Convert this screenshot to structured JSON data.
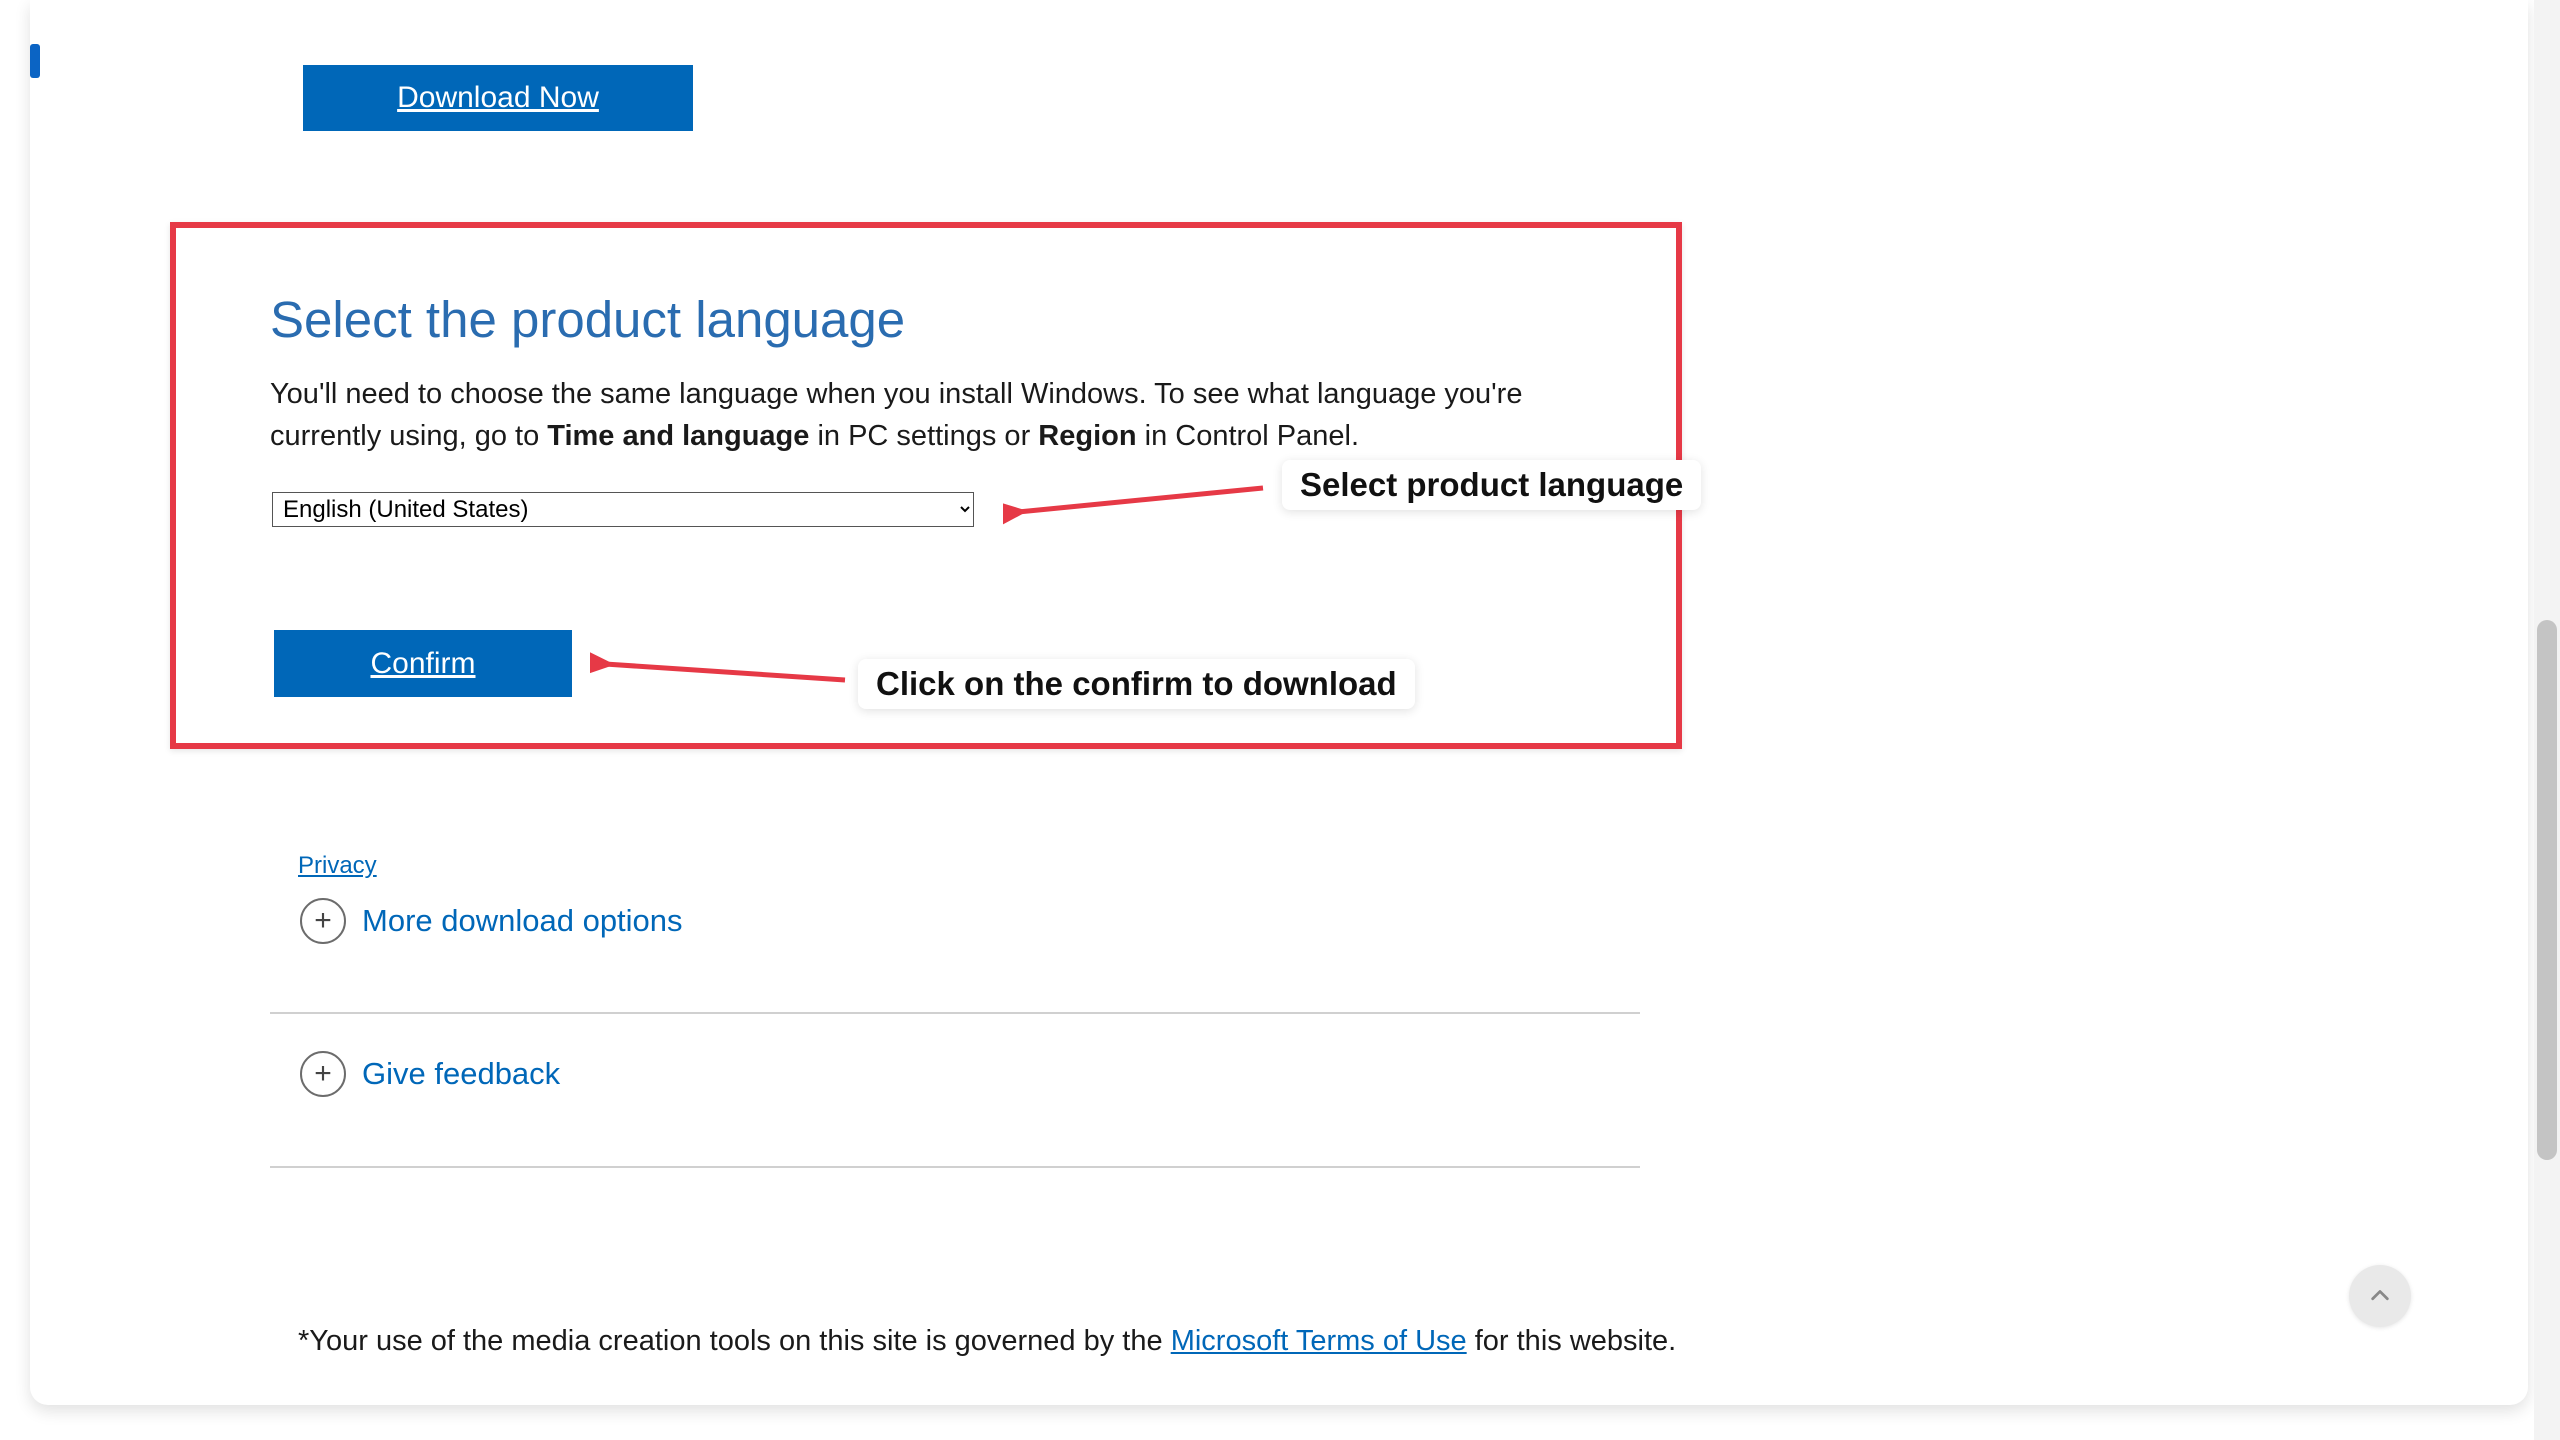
{
  "download_button": {
    "label": "Download Now"
  },
  "section": {
    "heading": "Select the product language",
    "body_prefix": "You'll need to choose the same language when you install Windows. To see what language you're currently using, go to ",
    "body_bold1": "Time and language",
    "body_mid": " in PC settings or ",
    "body_bold2": "Region",
    "body_suffix": " in Control Panel.",
    "select_value": "English (United States)",
    "confirm_label": "Confirm"
  },
  "annotations": {
    "select_callout": "Select product language",
    "confirm_callout": "Click on the confirm to download"
  },
  "links": {
    "privacy": "Privacy",
    "more_download": "More download options",
    "give_feedback": "Give feedback",
    "terms_link": "Microsoft Terms of Use"
  },
  "footnote": {
    "prefix": "*Your use of the media creation tools on this site is governed by the ",
    "suffix": " for this website."
  }
}
